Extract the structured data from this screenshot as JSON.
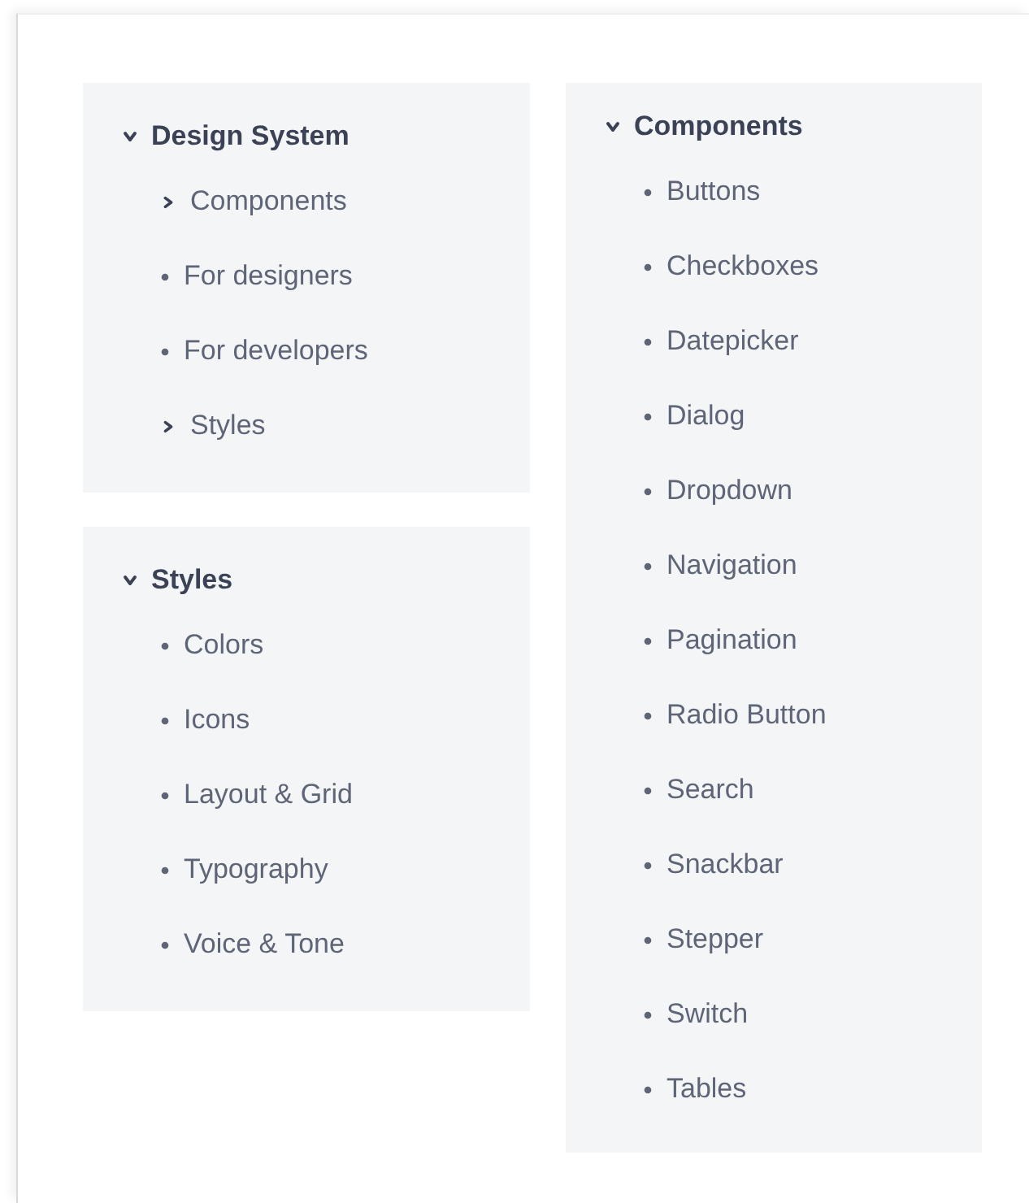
{
  "columns": [
    [
      {
        "title": "Design System",
        "expanded": true,
        "items": [
          {
            "label": "Components",
            "kind": "group",
            "expanded": false
          },
          {
            "label": "For designers",
            "kind": "page"
          },
          {
            "label": "For developers",
            "kind": "page"
          },
          {
            "label": "Styles",
            "kind": "group",
            "expanded": false
          }
        ]
      },
      {
        "title": "Styles",
        "expanded": true,
        "items": [
          {
            "label": "Colors",
            "kind": "page"
          },
          {
            "label": "Icons",
            "kind": "page"
          },
          {
            "label": "Layout & Grid",
            "kind": "page"
          },
          {
            "label": "Typography",
            "kind": "page"
          },
          {
            "label": "Voice & Tone",
            "kind": "page"
          }
        ]
      }
    ],
    [
      {
        "title": "Components",
        "expanded": true,
        "items": [
          {
            "label": "Buttons",
            "kind": "page"
          },
          {
            "label": "Checkboxes",
            "kind": "page"
          },
          {
            "label": "Datepicker",
            "kind": "page"
          },
          {
            "label": "Dialog",
            "kind": "page"
          },
          {
            "label": "Dropdown",
            "kind": "page"
          },
          {
            "label": "Navigation",
            "kind": "page"
          },
          {
            "label": "Pagination",
            "kind": "page"
          },
          {
            "label": "Radio Button",
            "kind": "page"
          },
          {
            "label": "Search",
            "kind": "page"
          },
          {
            "label": "Snackbar",
            "kind": "page"
          },
          {
            "label": "Stepper",
            "kind": "page"
          },
          {
            "label": "Switch",
            "kind": "page"
          },
          {
            "label": "Tables",
            "kind": "page"
          }
        ]
      }
    ]
  ]
}
